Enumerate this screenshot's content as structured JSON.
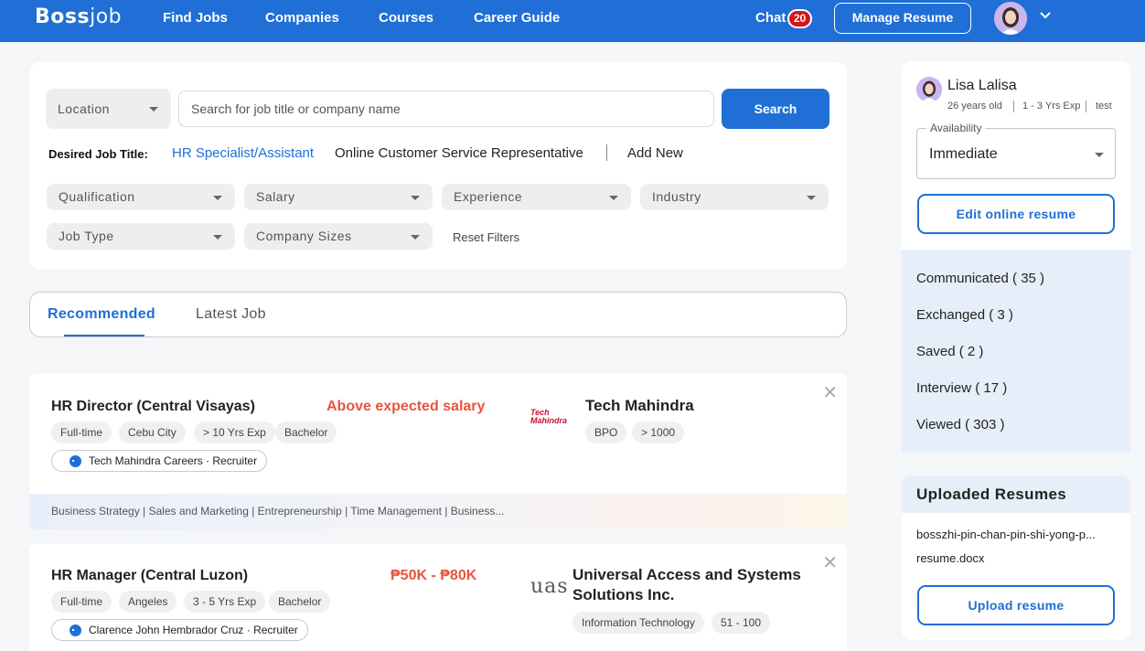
{
  "header": {
    "logo_bold": "Boss",
    "logo_light": "job",
    "nav": [
      "Find Jobs",
      "Companies",
      "Courses",
      "Career Guide"
    ],
    "chat_label": "Chat",
    "chat_count": "20",
    "manage_resume": "Manage Resume",
    "brand_color": "#1f6fd6"
  },
  "search": {
    "location_placeholder": "Location",
    "input_placeholder": "Search for job title or company name",
    "button": "Search",
    "desired_label": "Desired Job Title:",
    "desired_titles": [
      "HR Specialist/Assistant",
      "Online Customer Service Representative"
    ],
    "add_new": "Add New",
    "filters": [
      "Qualification",
      "Salary",
      "Experience",
      "Industry",
      "Job Type",
      "Company Sizes"
    ],
    "reset": "Reset Filters"
  },
  "tabs": [
    "Recommended",
    "Latest Job"
  ],
  "jobs": [
    {
      "title": "HR Director (Central Visayas)",
      "highlight": "Above expected salary",
      "tags": [
        "Full-time",
        "Cebu City",
        "> 10 Yrs Exp",
        "Bachelor"
      ],
      "recruiter": "Tech Mahindra Careers · Recruiter",
      "logo_line1": "Tech",
      "logo_line2": "Mahindra",
      "company": "Tech Mahindra",
      "company_tags": [
        "BPO",
        "> 1000"
      ],
      "skills": "Business Strategy | Sales and Marketing | Entrepreneurship | Time Management | Business..."
    },
    {
      "title": "HR Manager (Central Luzon)",
      "highlight": "₱50K - ₱80K",
      "tags": [
        "Full-time",
        "Angeles",
        "3 - 5 Yrs Exp",
        "Bachelor"
      ],
      "recruiter": "Clarence John Hembrador Cruz · Recruiter",
      "logo_text": "uas",
      "company_line1": "Universal Access and Systems",
      "company_line2": "Solutions Inc.",
      "company_tags": [
        "Information Technology",
        "51 - 100"
      ]
    }
  ],
  "profile": {
    "name": "Lisa Lalisa",
    "age": "26 years old",
    "experience": "1 - 3 Yrs Exp",
    "extra": "test",
    "availability_label": "Availability",
    "availability_value": "Immediate",
    "edit_button": "Edit online resume",
    "stats": [
      "Communicated ( 35 )",
      "Exchanged ( 3 )",
      "Saved ( 2 )",
      "Interview ( 17 )",
      "Viewed ( 303 )"
    ]
  },
  "uploads": {
    "heading": "Uploaded Resumes",
    "files": [
      "bosszhi-pin-chan-pin-shi-yong-p...",
      "resume.docx"
    ],
    "button": "Upload resume"
  }
}
